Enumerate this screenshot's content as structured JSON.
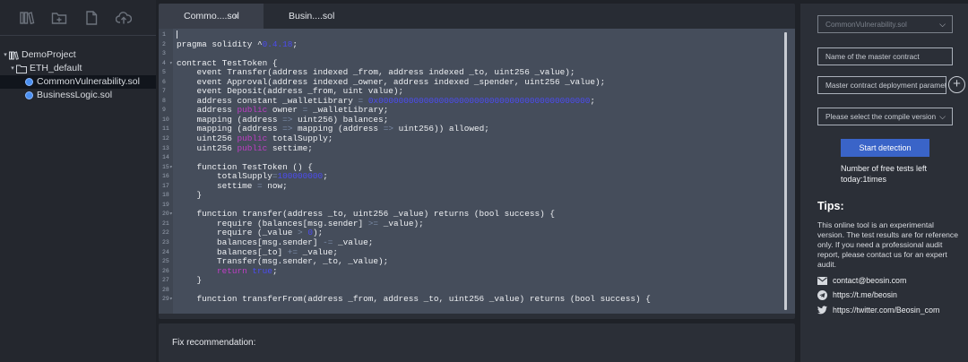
{
  "toolbar": {
    "icons": [
      "library-icon",
      "new-folder-icon",
      "new-file-icon",
      "upload-icon"
    ]
  },
  "tree": {
    "project": "DemoProject",
    "folder": "ETH_default",
    "files": [
      "CommonVulnerability.sol",
      "BusinessLogic.sol"
    ]
  },
  "tabs": [
    {
      "label": "Commo....sol",
      "close": "×"
    },
    {
      "label": "Busin....sol"
    }
  ],
  "code": [
    {
      "n": "1",
      "t": [],
      "fold": false
    },
    {
      "n": "2",
      "t": [
        [
          "pragma solidity ^",
          ""
        ],
        [
          "0.4.18",
          "num"
        ],
        [
          ";",
          ""
        ]
      ],
      "fold": false
    },
    {
      "n": "3",
      "t": [],
      "fold": false
    },
    {
      "n": "4",
      "t": [
        [
          "contract TestToken {",
          ""
        ]
      ],
      "fold": true
    },
    {
      "n": "5",
      "t": [
        [
          "    event Transfer(address indexed _from, address indexed _to, uint256 _value);",
          ""
        ]
      ],
      "fold": false
    },
    {
      "n": "6",
      "t": [
        [
          "    event Approval(address indexed _owner, address indexed _spender, uint256 _value);",
          ""
        ]
      ],
      "fold": false
    },
    {
      "n": "7",
      "t": [
        [
          "    event Deposit(address _from, uint value);",
          ""
        ]
      ],
      "fold": false
    },
    {
      "n": "8",
      "t": [
        [
          "    address constant _walletLibrary ",
          ""
        ],
        [
          "= ",
          "op"
        ],
        [
          "0x000000000000000000000000000000000000000000",
          "num"
        ],
        [
          ";",
          ""
        ]
      ],
      "fold": false
    },
    {
      "n": "9",
      "t": [
        [
          "    address ",
          ""
        ],
        [
          "public",
          "kw"
        ],
        [
          " owner ",
          ""
        ],
        [
          "=",
          "op"
        ],
        [
          " _walletLibrary;",
          ""
        ]
      ],
      "fold": false
    },
    {
      "n": "10",
      "t": [
        [
          "    mapping (address ",
          ""
        ],
        [
          "=>",
          "op"
        ],
        [
          " uint256) balances;",
          ""
        ]
      ],
      "fold": false
    },
    {
      "n": "11",
      "t": [
        [
          "    mapping (address ",
          ""
        ],
        [
          "=>",
          "op"
        ],
        [
          " mapping (address ",
          ""
        ],
        [
          "=>",
          "op"
        ],
        [
          " uint256)) allowed;",
          ""
        ]
      ],
      "fold": false
    },
    {
      "n": "12",
      "t": [
        [
          "    uint256 ",
          ""
        ],
        [
          "public",
          "kw"
        ],
        [
          " totalSupply;",
          ""
        ]
      ],
      "fold": false
    },
    {
      "n": "13",
      "t": [
        [
          "    uint256 ",
          ""
        ],
        [
          "public",
          "kw"
        ],
        [
          " settime;",
          ""
        ]
      ],
      "fold": false
    },
    {
      "n": "14",
      "t": [],
      "fold": false
    },
    {
      "n": "15",
      "t": [
        [
          "    function TestToken () {",
          ""
        ]
      ],
      "fold": true
    },
    {
      "n": "16",
      "t": [
        [
          "        totalSupply",
          ""
        ],
        [
          "=",
          "op"
        ],
        [
          "100000000",
          "num"
        ],
        [
          ";",
          ""
        ]
      ],
      "fold": false
    },
    {
      "n": "17",
      "t": [
        [
          "        settime ",
          ""
        ],
        [
          "=",
          "op"
        ],
        [
          " now;",
          ""
        ]
      ],
      "fold": false
    },
    {
      "n": "18",
      "t": [
        [
          "    }",
          ""
        ]
      ],
      "fold": false
    },
    {
      "n": "19",
      "t": [],
      "fold": false
    },
    {
      "n": "20",
      "t": [
        [
          "    function transfer(address _to, uint256 _value) returns (bool success) {",
          ""
        ]
      ],
      "fold": true
    },
    {
      "n": "21",
      "t": [
        [
          "        require (balances[msg.sender] ",
          ""
        ],
        [
          ">=",
          "op"
        ],
        [
          " _value);",
          ""
        ]
      ],
      "fold": false
    },
    {
      "n": "22",
      "t": [
        [
          "        require (_value ",
          ""
        ],
        [
          ">",
          "op"
        ],
        [
          " ",
          ""
        ],
        [
          "0",
          "num"
        ],
        [
          ");",
          ""
        ]
      ],
      "fold": false
    },
    {
      "n": "23",
      "t": [
        [
          "        balances[msg.sender] ",
          ""
        ],
        [
          "-=",
          "op"
        ],
        [
          " _value;",
          ""
        ]
      ],
      "fold": false
    },
    {
      "n": "24",
      "t": [
        [
          "        balances[_to] ",
          ""
        ],
        [
          "+=",
          "op"
        ],
        [
          " _value;",
          ""
        ]
      ],
      "fold": false
    },
    {
      "n": "25",
      "t": [
        [
          "        Transfer(msg.sender, _to, _value);",
          ""
        ]
      ],
      "fold": false
    },
    {
      "n": "26",
      "t": [
        [
          "        ",
          ""
        ],
        [
          "return",
          "kw"
        ],
        [
          " ",
          ""
        ],
        [
          "true",
          "num"
        ],
        [
          ";",
          ""
        ]
      ],
      "fold": false
    },
    {
      "n": "27",
      "t": [
        [
          "    }",
          ""
        ]
      ],
      "fold": false
    },
    {
      "n": "28",
      "t": [],
      "fold": false
    },
    {
      "n": "29",
      "t": [
        [
          "    function transferFrom(address _from, address _to, uint256 _value) returns (bool success) {",
          ""
        ]
      ],
      "fold": true
    }
  ],
  "fix": {
    "label": "Fix recommendation:"
  },
  "right": {
    "file_select": "CommonVulnerability.sol",
    "contract_name_placeholder": "Name of the master contract",
    "deploy_params_placeholder": "Master contract deployment parameters",
    "plus": "+",
    "compile_select": "Please select the compile version",
    "chevron": "⌵",
    "start_button": "Start detection",
    "free_tests": "Number of free tests left today:1times",
    "tips_title": "Tips:",
    "tips_text": "This online tool is an experimental version. The test results are for reference only. If you need a professional audit report, please contact us for an expert audit.",
    "contacts": [
      {
        "icon": "mail-icon",
        "text": "contact@beosin.com"
      },
      {
        "icon": "telegram-icon",
        "text": "https://t.me/beosin"
      },
      {
        "icon": "twitter-icon",
        "text": "https://twitter.com/Beosin_com"
      }
    ]
  },
  "colors": {
    "keyword": "#c03ec6",
    "number": "#4c4cf0",
    "button": "#3a64c8",
    "file_dot": "#4a8ff0"
  }
}
